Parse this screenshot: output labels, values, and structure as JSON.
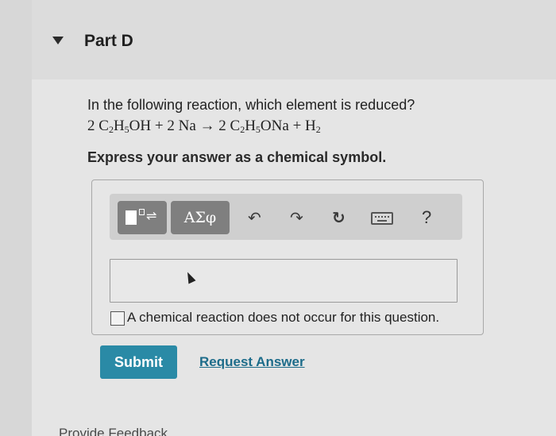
{
  "part": {
    "title": "Part D"
  },
  "question": {
    "prompt": "In the following reaction, which element is reduced?",
    "equation": {
      "c1": "2",
      "c2": "C",
      "c2s": "2",
      "c3": "H",
      "c3s": "5",
      "c4": "OH",
      "plus1": "+",
      "c5": "2",
      "c6": "Na",
      "arrow": "→",
      "c7": "2",
      "c8": "C",
      "c8s": "2",
      "c9": "H",
      "c9s": "5",
      "c10": "ONa",
      "plus2": "+",
      "c11": "H",
      "c11s": "2"
    },
    "instruction": "Express your answer as a chemical symbol."
  },
  "toolbar": {
    "template_arrows": "⇌",
    "greek_label": "ΑΣφ",
    "undo_glyph": "↶",
    "redo_glyph": "↷",
    "reset_glyph": "↻",
    "help_label": "?"
  },
  "answer": {
    "value": ""
  },
  "options": {
    "no_reaction_label": "A chemical reaction does not occur for this question."
  },
  "actions": {
    "submit_label": "Submit",
    "request_label": "Request Answer",
    "feedback_label": "Provide Feedback"
  },
  "colors": {
    "submit_bg": "#2a8aa6",
    "link": "#1d6c8a",
    "toolbar_btn": "#7f7f7f"
  }
}
